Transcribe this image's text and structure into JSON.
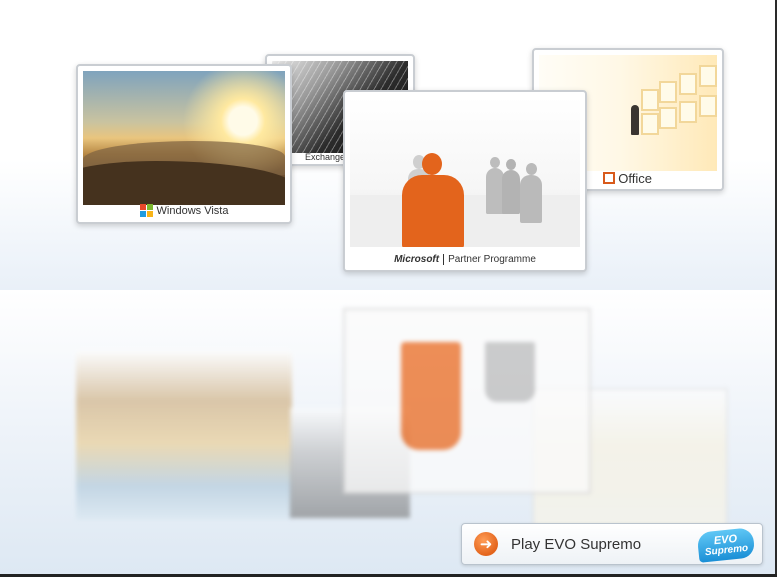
{
  "cards": {
    "vista": {
      "label": "Windows Vista"
    },
    "exchange": {
      "label": "Exchange S"
    },
    "office": {
      "label": "Office"
    },
    "partner": {
      "brand": "Microsoft",
      "label": "Partner Programme"
    }
  },
  "play": {
    "label": "Play EVO Supremo",
    "icon": "arrow-right-icon",
    "logo_line1": "EVO",
    "logo_line2": "Supremo"
  },
  "colors": {
    "accent_orange": "#e3641c",
    "figure_gray": "#b9b9b9",
    "evo_blue": "#1a8fd6"
  }
}
